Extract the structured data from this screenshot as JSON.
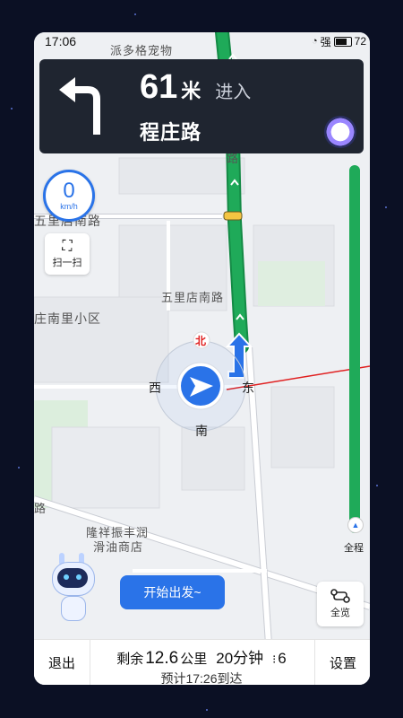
{
  "status": {
    "time": "17:06",
    "signal_text": "强",
    "battery": "72"
  },
  "nav": {
    "distance": "61",
    "unit": "米",
    "action": "进入",
    "road": "程庄路"
  },
  "speed": {
    "value": "0",
    "unit": "km/h"
  },
  "scan": {
    "label": "扫一扫"
  },
  "compass": {
    "north": "北",
    "south": "南",
    "east": "东",
    "west": "西"
  },
  "map_labels": {
    "poi_top": "派多格宠物",
    "road_1": "五里店南路",
    "road_2": "五里店南路",
    "area_1": "庄南里小区",
    "poi_bottom_1": "隆祥振丰润",
    "poi_bottom_2": "滑油商店",
    "road_left": "路",
    "road_top": "路"
  },
  "progress": {
    "label": "全程",
    "fraction": 0.0
  },
  "start_button": {
    "label": "开始出发~"
  },
  "overview_button": {
    "label": "全览"
  },
  "bottom": {
    "exit_label": "退出",
    "remaining_prefix": "剩余",
    "remaining_distance": "12.6",
    "distance_unit": "公里",
    "remaining_time": "20分钟",
    "traffic_lights": "6",
    "eta": "预计17:26到达",
    "settings_label": "设置"
  },
  "colors": {
    "route_green": "#1faa59",
    "nav_card_bg": "#1f2530",
    "accent_blue": "#2a73e8"
  }
}
